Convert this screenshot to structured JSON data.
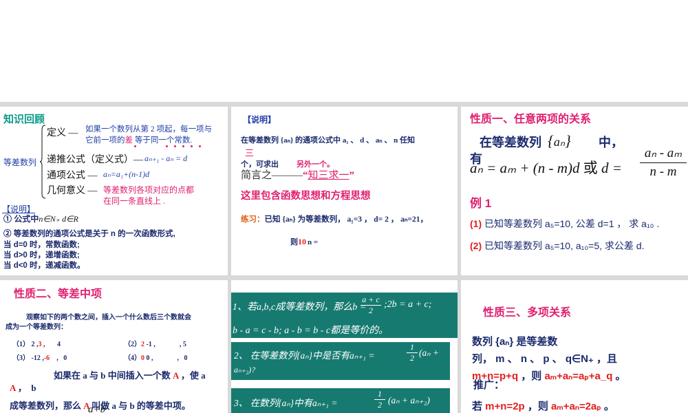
{
  "panel1": {
    "title": "知识回顾",
    "side_label": "等差数列",
    "def_label": "定义 —",
    "def_text_1": "如果一个数列从第 2 项起，每一项与",
    "def_text_2a": "它前一项的",
    "def_text_2b": "差",
    "def_text_2c": " 等于同一个常数",
    "def_text_2d": ".",
    "recur_label": "递推公式（定义式）—",
    "recur_formula": "aₙ₊₁ - aₙ = d",
    "general_label": "通项公式 —",
    "general_formula": "aₙ=a₁+(n-1)d",
    "geo_label": "几何意义 —",
    "geo_text_1": "等差数列各项对应的点都",
    "geo_text_2": "在同一条直线上 .",
    "note_label": "【说明】",
    "note_1": "① 公式中",
    "note_1_math": "n∈N₊  d∈R",
    "note_2": "② 等差数列的通项公式是关于 n 的一次函数形式,",
    "note_3": "当 d=0 时，常数函数;",
    "note_4": "当 d>0 时，递增函数;",
    "note_5": "当 d<0 时，递减函数。"
  },
  "panel2": {
    "label": "【说明】",
    "line1": "在等差数列 {aₙ} 的通项公式中   a₁ 、 d 、 aₙ 、 n  任知",
    "line1_cont": "三",
    "line2a": "个，可求出",
    "line2b": "另外一个。",
    "summary_a": "简言之———",
    "summary_b": "“",
    "summary_c": "知三求一",
    "summary_d": "”",
    "idea": "这里包含函数思想和方程思想",
    "exercise_label": "练习：",
    "exercise_text": "已知 {aₙ} 为等差数列，   a₁=3 ，  d= 2  ，   aₙ=21，",
    "then_text": "则",
    "then_n": "n =",
    "then_value": "10"
  },
  "panel3": {
    "title": "性质一、任意两项的关系",
    "lead": "在等差数列",
    "seq": "aₙ",
    "lead_end": "中，",
    "have": "有",
    "formula": "aₙ = aₘ + (n - m)d",
    "or": "或",
    "d_eq": "d =",
    "frac_num": "aₙ - aₘ",
    "frac_den": "n - m",
    "example": "例 1",
    "q1_num": "(1)",
    "q1_text": "已知等差数列 a₅=10, 公差 d=1 ， 求 a₁₀ .",
    "q2_num": "(2)",
    "q2_text": "已知等差数列 a₅=10, a₁₀=5, 求公差 d."
  },
  "panel4": {
    "title": "性质二、等差中项",
    "intro_1": "观察如下的两个数之间，插入一个什么数后三个数就会",
    "intro_2": "成为一个等差数列：",
    "row1_a": "（1） 2 ,",
    "row1_a_ans": "3",
    "row1_a_end": " ,       4",
    "row1_b": "（2）",
    "row1_b_ans": "2",
    "row1_b_end": " -1 ,              , 5",
    "row2_a": "（3） -12 ,",
    "row2_a_ans": "-6",
    "row2_a_end": "    ,   0",
    "row2_b": "（4）",
    "row2_b_ans": "0",
    "row2_b_end": " 0 ,              ,   0",
    "text_1a": "如果在 a 与 b 中间插入一个数 ",
    "text_1b": "A",
    "text_1c": " ，使 a",
    "text_2a": "A",
    "text_2b": " ，  b",
    "text_3a": "成等差数列，那么 ",
    "text_3b": "A",
    "text_3c": " 叫做 a 与 b 的等差中项。",
    "bottom_frac": "a+b"
  },
  "panel5": {
    "box1_line1": "1、若a,b,c成等差数列，那么b =",
    "box1_frac_num": "a + c",
    "box1_frac_den": "2",
    "box1_line1_end": ";2b = a + c;",
    "box1_line2": "b - a = c - b; a - b = b - c都是等价的。",
    "box2_line1": "2、 在等差数列{aₙ}中是否有aₙ₊₁ =",
    "box2_frac_num": "1",
    "box2_frac_den": "2",
    "box2_line1_end": "(aₙ +",
    "box2_line2": "aₙ₊₂)?",
    "box3_line": "3、 在数列{aₙ}中有aₙ₊₁ =",
    "box3_frac_num": "1",
    "box3_frac_den": "2",
    "box3_end": "(aₙ + aₙ₊₂)"
  },
  "panel6": {
    "title": "性质三、多项关系",
    "l1": "数列 {aₙ} 是等差数",
    "l2": "列， m 、 n 、 p 、  q∈N₊ ，且",
    "l3a": "m+n=p+q",
    "l3b": " ，则 ",
    "l3c": "aₘ+aₙ=aₚ+a_q",
    "l3d": " 。",
    "push": "推广：",
    "l4a": "若 ",
    "l4b": "m+n=2p",
    "l4c": " ，则 ",
    "l4d": "aₘ+aₙ=2aₚ",
    "l4e": " 。"
  }
}
